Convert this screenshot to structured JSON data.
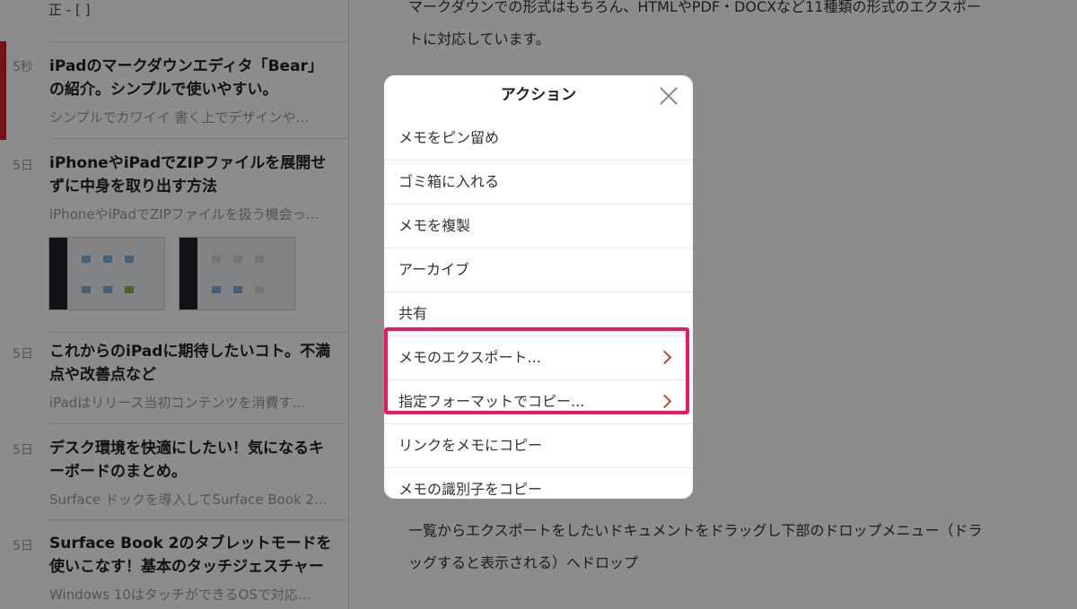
{
  "sidebar": {
    "top_fragment": "正 - [ ]",
    "notes": [
      {
        "age": "5秒",
        "title": "iPadのマークダウンエディタ「Bear」の紹介。シンプルで使いやすい。",
        "preview": "シンプルでカワイイ 書く上でデザインや…"
      },
      {
        "age": "5日",
        "title": "iPhoneやiPadでZIPファイルを展開せずに中身を取り出す方法",
        "preview": "iPhoneやiPadでZIPファイルを扱う機会っ…"
      },
      {
        "age": "5日",
        "title": "これからのiPadに期待したいコト。不満点や改善点など",
        "preview": "iPadはリリース当初コンテンツを消費す…"
      },
      {
        "age": "5日",
        "title": "デスク環境を快適にしたい！気になるキーボードのまとめ。",
        "preview": "Surface ドックを導入してSurface Book 2…"
      },
      {
        "age": "5日",
        "title": "Surface Book 2のタブレットモードを使いこなす！基本のタッチジェスチャー",
        "preview": "Windows 10はタッチができるOSで対応…"
      }
    ]
  },
  "main": {
    "para_top": "マークダウンでの形式はもちろん、HTMLやPDF・DOCXなど11種類の形式のエクスポートに対応しています。",
    "para_bottom": "一覧からエクスポートをしたいドキュメントをドラッグし下部のドロップメニュー（ドラッグすると表示される）へドロップ"
  },
  "action_sheet": {
    "title": "アクション",
    "close_icon": "close-icon",
    "items": [
      {
        "label": "メモをピン留め"
      },
      {
        "label": "ゴミ箱に入れる"
      },
      {
        "label": "メモを複製"
      },
      {
        "label": "アーカイブ"
      },
      {
        "label": "共有"
      },
      {
        "label": "メモのエクスポート..."
      },
      {
        "label": "指定フォーマットでコピー..."
      },
      {
        "label": "リンクをメモにコピー"
      },
      {
        "label": "メモの識別子をコピー"
      }
    ]
  },
  "colors": {
    "accent_red": "#d4262f",
    "highlight_pink": "#e8195f",
    "chevron": "#c2413b"
  }
}
